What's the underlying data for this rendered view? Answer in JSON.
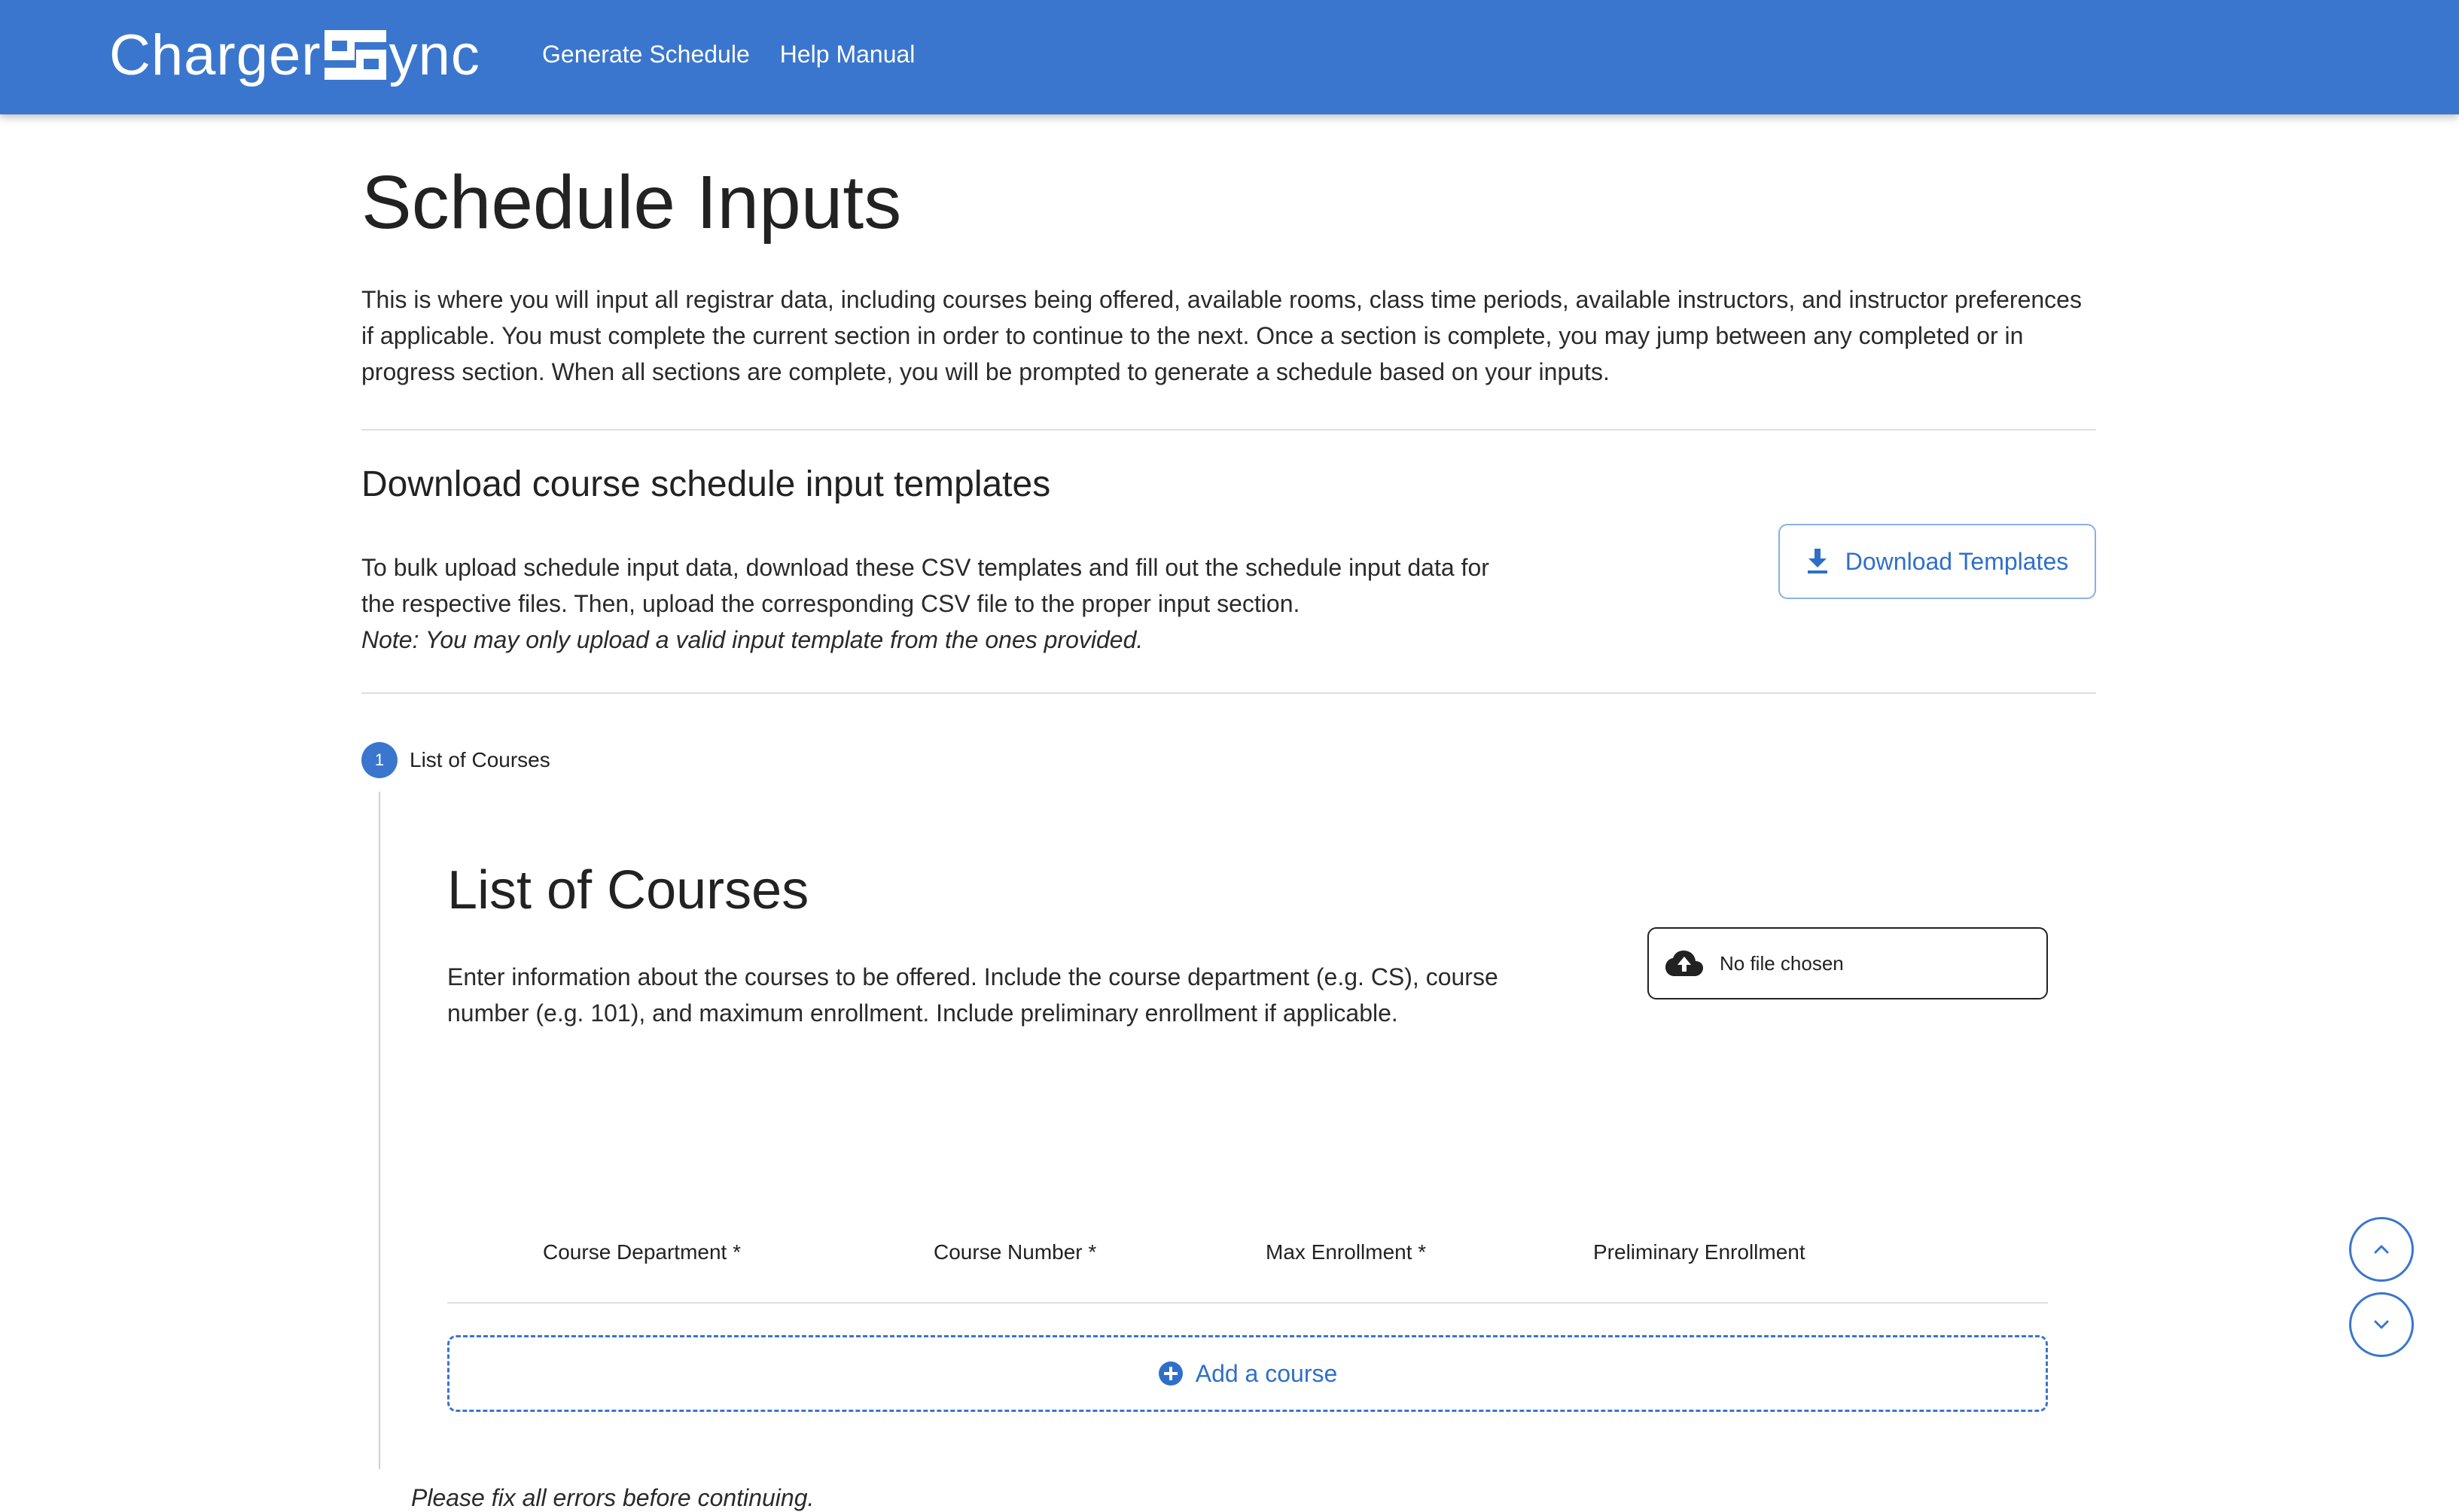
{
  "header": {
    "brand_left": "Charger",
    "brand_right": "ync",
    "nav": [
      {
        "label": "Generate Schedule"
      },
      {
        "label": "Help Manual"
      }
    ]
  },
  "page": {
    "title": "Schedule Inputs",
    "intro": "This is where you will input all registrar data, including courses being offered, available rooms, class time periods, available instructors, and instructor preferences if applicable. You must complete the current section in order to continue to the next. Once a section is complete, you may jump between any completed or in progress section. When all sections are complete, you will be prompted to generate a schedule based on your inputs."
  },
  "templates": {
    "heading": "Download course schedule input templates",
    "description": "To bulk upload schedule input data, download these CSV templates and fill out the schedule input data for the respective files. Then, upload the corresponding CSV file to the proper input section.",
    "note": "Note: You may only upload a valid input template from the ones provided.",
    "button_label": "Download Templates"
  },
  "stepper": {
    "step_number": "1",
    "step_label": "List of Courses"
  },
  "courses": {
    "title": "List of Courses",
    "description": "Enter information about the courses to be offered. Include the course department (e.g. CS), course number (e.g. 101), and maximum enrollment. Include preliminary enrollment if applicable.",
    "file_input_label": "No file chosen",
    "columns": [
      "Course Department *",
      "Course Number *",
      "Max Enrollment *",
      "Preliminary Enrollment"
    ],
    "add_label": "Add a course",
    "error_message": "Please fix all errors before continuing."
  },
  "colors": {
    "primary": "#3a76cd",
    "link": "#2f6fc9",
    "text": "#222222",
    "divider": "#dedede"
  },
  "icons": {
    "download": "download-icon",
    "upload": "cloud-upload-icon",
    "add": "plus-circle-icon",
    "scroll_up": "chevron-up-icon",
    "scroll_down": "chevron-down-icon"
  }
}
